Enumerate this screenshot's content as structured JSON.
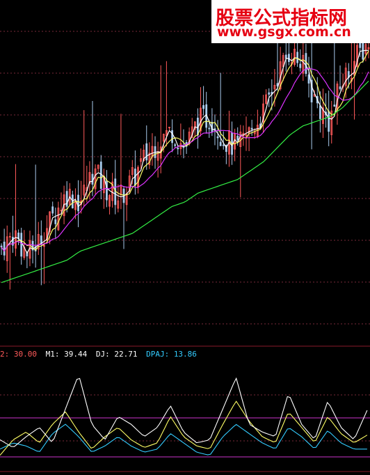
{
  "watermark": {
    "title": "股票公式指标网",
    "url": "www.gsgx.com.cn"
  },
  "indicator_legend": {
    "items": [
      {
        "key": "t2",
        "text": "2: 30.00",
        "color": "#ff5a5a"
      },
      {
        "key": "m1",
        "text": "M1: 39.44",
        "color": "#ffffff"
      },
      {
        "key": "dj",
        "text": "DJ: 22.71",
        "color": "#ffffff"
      },
      {
        "key": "dpaj",
        "text": "DPAJ: 13.86",
        "color": "#33ccff"
      }
    ]
  },
  "colors": {
    "background": "#000000",
    "up_candle": "#ff5a5a",
    "down_candle": "#aaccee",
    "ma_white": "#ffffff",
    "ma_yellow": "#ffff66",
    "ma_magenta": "#dd33ff",
    "ma_green": "#33ee44",
    "grid": "#7a2a3a",
    "indicator_cyan": "#33ccff",
    "ref_line_magenta": "#cc33cc"
  },
  "chart_data": [
    {
      "type": "candlestick",
      "description_series": [
        "price candles",
        "MA white",
        "MA yellow",
        "MA magenta",
        "MA green"
      ],
      "trend": [
        18,
        21,
        16,
        20,
        25,
        30,
        28,
        35,
        31,
        29,
        33,
        38,
        42,
        44,
        40,
        46,
        47,
        42,
        40,
        44,
        48,
        56,
        62,
        58,
        50,
        46,
        55,
        60,
        64
      ],
      "ma_slow": [
        10,
        11,
        12,
        13,
        14,
        15,
        17,
        18,
        19,
        20,
        21,
        23,
        25,
        27,
        28,
        30,
        31,
        32,
        33,
        35,
        37,
        40,
        43,
        45,
        46,
        47,
        49,
        52,
        55
      ]
    },
    {
      "type": "line",
      "series_names": [
        "M1",
        "DJ",
        "DPAJ"
      ],
      "M1": [
        20,
        15,
        22,
        28,
        18,
        40,
        62,
        30,
        20,
        35,
        30,
        22,
        28,
        42,
        25,
        18,
        20,
        40,
        60,
        30,
        25,
        22,
        50,
        30,
        20,
        45,
        28,
        20,
        39
      ],
      "DJ": [
        10,
        20,
        25,
        18,
        30,
        38,
        25,
        14,
        22,
        28,
        20,
        15,
        18,
        35,
        22,
        16,
        14,
        30,
        45,
        32,
        22,
        18,
        38,
        28,
        18,
        35,
        24,
        18,
        23
      ],
      "DPAJ": [
        14,
        18,
        16,
        12,
        24,
        30,
        22,
        12,
        16,
        22,
        16,
        12,
        14,
        24,
        18,
        12,
        10,
        22,
        30,
        24,
        18,
        14,
        28,
        22,
        14,
        26,
        18,
        14,
        14
      ]
    }
  ]
}
